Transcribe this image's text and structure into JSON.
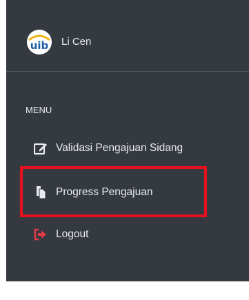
{
  "user": {
    "name": "Li Cen",
    "logo_text": "uib"
  },
  "menu": {
    "header": "MENU",
    "items": [
      {
        "label": "Validasi Pengajuan Sidang",
        "icon": "edit-icon"
      },
      {
        "label": "Progress Pengajuan",
        "icon": "copy-icon"
      },
      {
        "label": "Logout",
        "icon": "sign-out-icon"
      }
    ]
  },
  "colors": {
    "sidebar_bg": "#343a40",
    "text": "#e9ecef",
    "logout_icon": "#e53946",
    "highlight_border": "#e8101c",
    "logo_blue": "#1f5fa8",
    "logo_yellow": "#f2b316"
  }
}
